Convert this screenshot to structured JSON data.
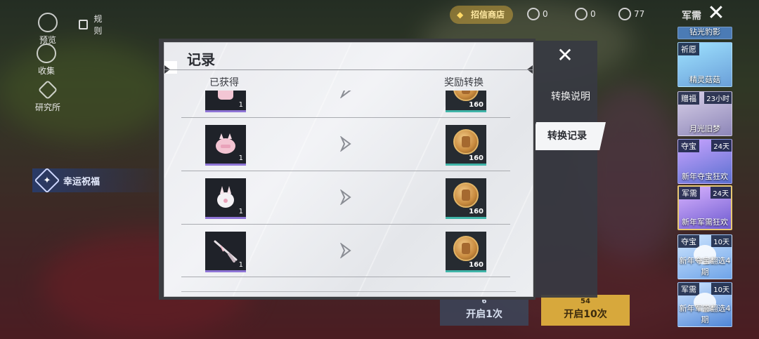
{
  "hud": {
    "preview": "预览",
    "rules": "规则",
    "collect": "收集",
    "institute": "研究所",
    "lucky": "幸运祝福"
  },
  "top": {
    "badge": "招信商店",
    "currency1": "0",
    "currency2": "0",
    "currency3": "77",
    "title": "军需"
  },
  "events": [
    {
      "tag": "",
      "time": "",
      "name": "钻光豹影"
    },
    {
      "tag": "祈愿",
      "time": "",
      "name": "精灵菇菇"
    },
    {
      "tag": "赠福",
      "time": "23小时",
      "name": "月光旧梦"
    },
    {
      "tag": "夺宝",
      "time": "24天",
      "name": "新年夺宝狂欢"
    },
    {
      "tag": "军需",
      "time": "24天",
      "name": "新年军需狂欢"
    },
    {
      "tag": "夺宝",
      "time": "10天",
      "name": "新年夺宝翻选4期"
    },
    {
      "tag": "军需",
      "time": "10天",
      "name": "新年军需翻选4期"
    }
  ],
  "open_buttons": {
    "single": {
      "cost": "6",
      "label": "开启1次"
    },
    "ten": {
      "cost": "54",
      "label": "开启10次"
    }
  },
  "modal": {
    "title": "记录",
    "col_obtained": "已获得",
    "col_reward": "奖励转换",
    "rows": [
      {
        "item": "pink-bag",
        "qty": "1",
        "reward": "160"
      },
      {
        "item": "pink-bunny-backpack",
        "qty": "1",
        "reward": "160"
      },
      {
        "item": "white-backpack",
        "qty": "1",
        "reward": "160"
      },
      {
        "item": "rifle",
        "qty": "1",
        "reward": "160"
      }
    ]
  },
  "tabs": {
    "explain": "转换说明",
    "record": "转换记录"
  }
}
